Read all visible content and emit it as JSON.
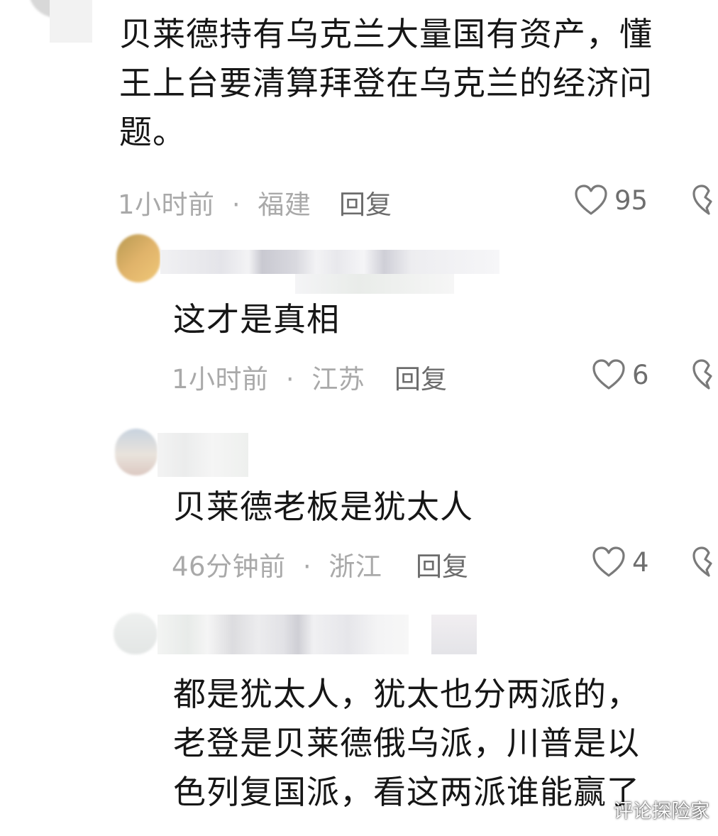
{
  "comments": [
    {
      "lines": [
        "贝莱德持有乌克兰大量国有资产，懂",
        "王上台要清算拜登在乌克兰的经济问",
        "题。"
      ],
      "time": "1小时前",
      "location": "福建",
      "reply_label": "回复",
      "likes": "95"
    },
    {
      "lines": [
        "这才是真相"
      ],
      "time": "1小时前",
      "location": "江苏",
      "reply_label": "回复",
      "likes": "6"
    },
    {
      "lines": [
        "贝莱德老板是犹太人"
      ],
      "time": "46分钟前",
      "location": "浙江",
      "reply_label": "回复",
      "likes": "4"
    },
    {
      "lines": [
        "都是犹太人，犹太也分两派的，",
        "老登是贝莱德俄乌派，川普是以",
        "色列复国派，看这两派谁能赢了"
      ]
    }
  ],
  "meta_separator": "·",
  "watermark": "评论探险家",
  "icons": {
    "like": "heart-outline-icon",
    "dislike": "broken-heart-icon"
  },
  "colors": {
    "text": "#161616",
    "meta": "#a9a9a9",
    "reply": "#6c6c6c",
    "icon": "#7a7a7a"
  }
}
